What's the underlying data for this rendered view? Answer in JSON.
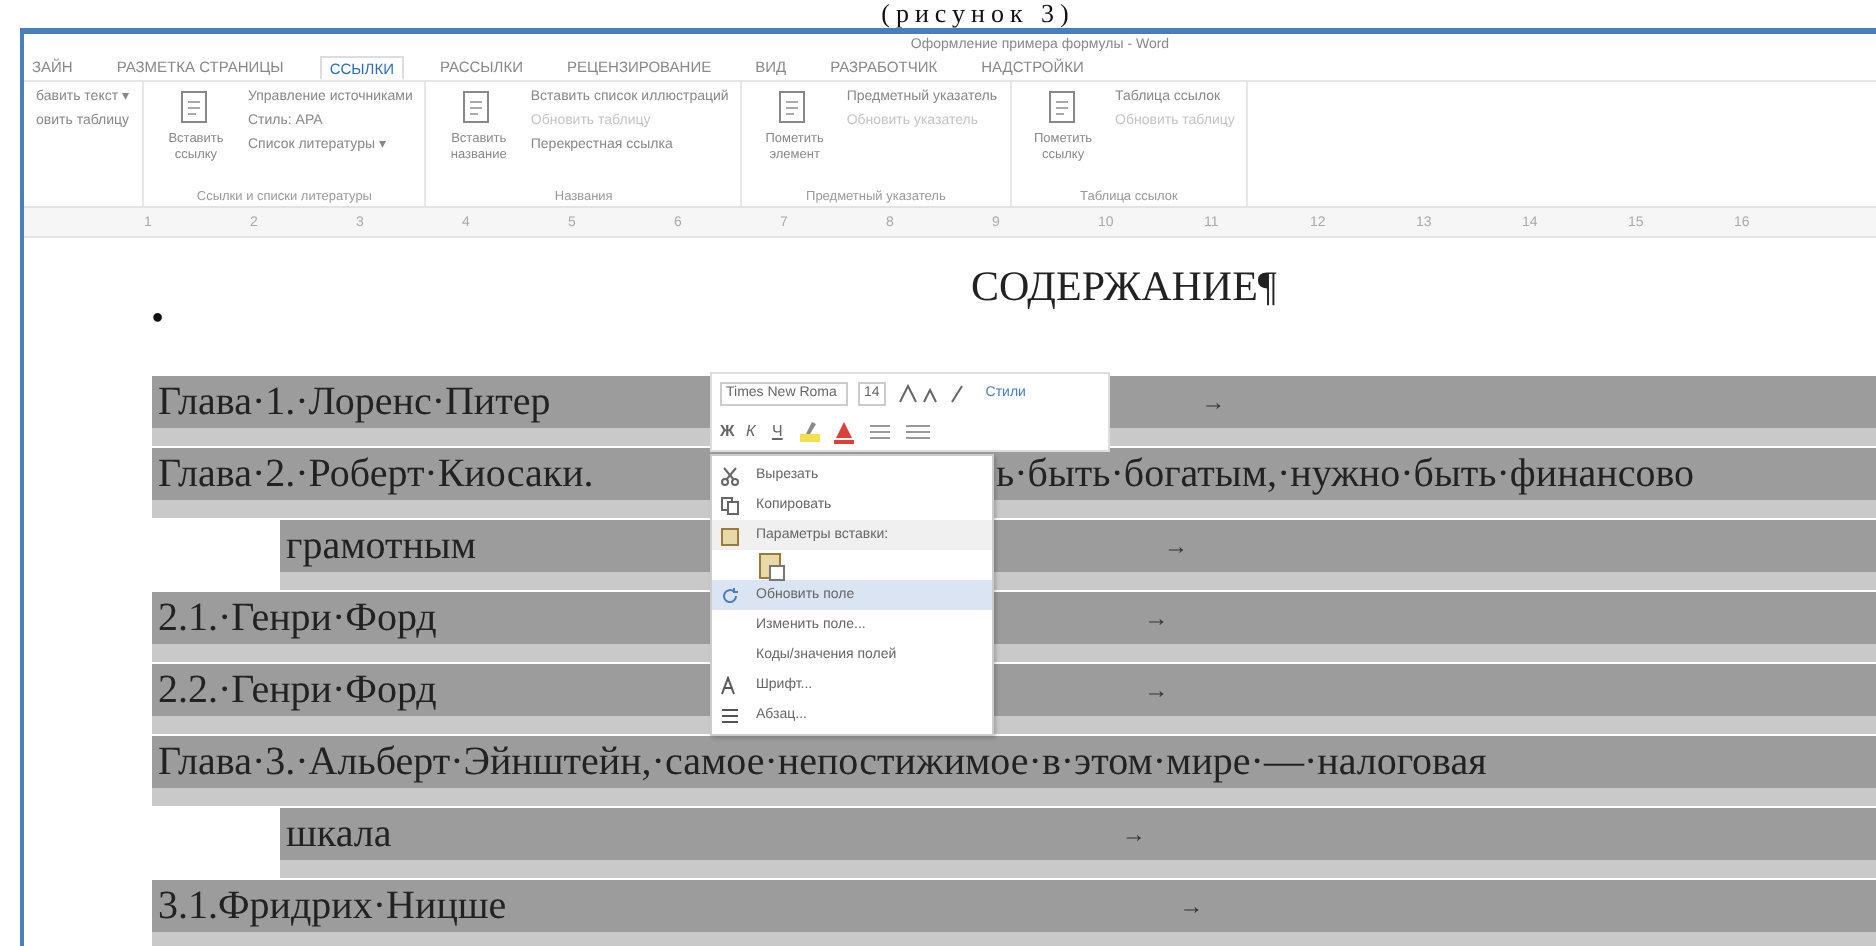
{
  "caption": "(рисунок 3)",
  "window": {
    "title": "Оформление примера формулы - Word"
  },
  "tabs": [
    {
      "label": "ЗАЙН",
      "selected": false
    },
    {
      "label": "РАЗМЕТКА СТРАНИЦЫ",
      "selected": false
    },
    {
      "label": "ССЫЛКИ",
      "selected": true
    },
    {
      "label": "РАССЫЛКИ",
      "selected": false
    },
    {
      "label": "РЕЦЕНЗИРОВАНИЕ",
      "selected": false
    },
    {
      "label": "ВИД",
      "selected": false
    },
    {
      "label": "РАЗРАБОТЧИК",
      "selected": false
    },
    {
      "label": "НАДСТРОЙКИ",
      "selected": false
    }
  ],
  "ribbon": [
    {
      "items": [
        {
          "label": "бавить текст ▾",
          "disabled": false
        },
        {
          "label": "овить таблицу",
          "disabled": false
        }
      ]
    },
    {
      "label": "Ссылки и списки литературы",
      "big": "Вставить ссылку",
      "items": [
        {
          "label": "Управление источниками",
          "disabled": false
        },
        {
          "label": "Стиль: APA",
          "disabled": false
        },
        {
          "label": "Список литературы ▾",
          "disabled": false
        }
      ]
    },
    {
      "label": "Названия",
      "big": "Вставить название",
      "items": [
        {
          "label": "Вставить список иллюстраций",
          "disabled": false
        },
        {
          "label": "Обновить таблицу",
          "disabled": true
        },
        {
          "label": "Перекрестная ссылка",
          "disabled": false
        }
      ]
    },
    {
      "label": "Предметный указатель",
      "big": "Пометить элемент",
      "items": [
        {
          "label": "Предметный указатель",
          "disabled": false
        },
        {
          "label": "Обновить указатель",
          "disabled": true
        }
      ]
    },
    {
      "label": "Таблица ссылок",
      "big": "Пометить ссылку",
      "items": [
        {
          "label": "Таблица ссылок",
          "disabled": false
        },
        {
          "label": "Обновить таблицу",
          "disabled": true
        }
      ]
    }
  ],
  "ruler": [
    "1",
    "2",
    "3",
    "4",
    "5",
    "6",
    "7",
    "8",
    "9",
    "10",
    "11",
    "12",
    "13",
    "14",
    "15",
    "16"
  ],
  "document": {
    "heading": "СОДЕРЖАНИЕ¶",
    "bullet": "•",
    "toc": [
      {
        "text": "Глава·1.·Лоренс·Питер",
        "indent": false,
        "tab": "→"
      },
      {
        "text": "Глава·2.·Роберт·Киосаки.",
        "after_menu": "ь·быть·богатым,·нужно·быть·финансово",
        "indent": false
      },
      {
        "text": "грамотным",
        "indent": true,
        "tab": "→"
      },
      {
        "text": "2.1.·Генри·Форд",
        "indent": false,
        "tab": "→"
      },
      {
        "text": "2.2.·Генри·Форд",
        "indent": false,
        "tab": "→"
      },
      {
        "text": "Глава·3.·Альберт·Эйнштейн,·самое·непостижимое·в·этом·мире·—·налоговая",
        "indent": false
      },
      {
        "text": "шкала",
        "indent": true,
        "tab": "→"
      },
      {
        "text": "3.1.Фридрих·Ницше",
        "indent": false,
        "tab": "→"
      }
    ]
  },
  "mini_toolbar": {
    "font": "Times New Roma",
    "size": "14",
    "styles": "Стили",
    "bold": "Ж",
    "italic": "К",
    "underline": "Ч"
  },
  "context_menu": [
    {
      "kind": "item",
      "label": "Вырезать",
      "selected": false
    },
    {
      "kind": "item",
      "label": "Копировать",
      "selected": false
    },
    {
      "kind": "header",
      "label": "Параметры вставки:",
      "selected": false
    },
    {
      "kind": "paste",
      "selected": false
    },
    {
      "kind": "item",
      "label": "Обновить поле",
      "selected": true
    },
    {
      "kind": "item",
      "label": "Изменить поле...",
      "selected": false
    },
    {
      "kind": "item",
      "label": "Коды/значения полей",
      "selected": false
    },
    {
      "kind": "item",
      "label": "Шрифт...",
      "selected": false
    },
    {
      "kind": "item",
      "label": "Абзац...",
      "selected": false
    }
  ]
}
